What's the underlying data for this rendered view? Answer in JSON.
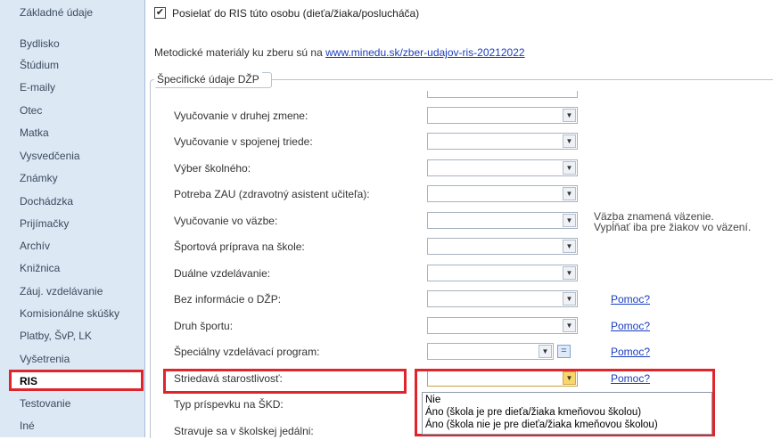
{
  "sidebar": {
    "items": [
      {
        "label": "Základné údaje"
      },
      {
        "label": "Bydlisko"
      },
      {
        "label": "Štúdium"
      },
      {
        "label": "E-maily"
      },
      {
        "label": "Otec"
      },
      {
        "label": "Matka"
      },
      {
        "label": "Vysvedčenia"
      },
      {
        "label": "Známky"
      },
      {
        "label": "Dochádzka"
      },
      {
        "label": "Prijímačky"
      },
      {
        "label": "Archív"
      },
      {
        "label": "Knižnica"
      },
      {
        "label": "Záuj. vzdelávanie"
      },
      {
        "label": "Komisionálne skúšky"
      },
      {
        "label": "Platby, ŠvP, LK"
      },
      {
        "label": "Vyšetrenia"
      },
      {
        "label": "RIS"
      },
      {
        "label": "Testovanie"
      },
      {
        "label": "Iné"
      }
    ],
    "active": "RIS"
  },
  "main": {
    "send_checkbox": {
      "checked": true,
      "check_glyph": "✔",
      "label": "Posielať do RIS túto osobu (dieťa/žiaka/poslucháča)"
    },
    "methodology_text": "Metodické materiály ku zberu sú na",
    "methodology_link": "www.minedu.sk/zber-udajov-ris-20212022",
    "group_title": "Špecifické údaje DŽP",
    "rows": [
      {
        "label": "Vyučovanie v druhej zmene:",
        "value": ""
      },
      {
        "label": "Vyučovanie v spojenej triede:",
        "value": ""
      },
      {
        "label": "Výber školného:",
        "value": ""
      },
      {
        "label": "Potreba ZAU (zdravotný asistent učiteľa):",
        "value": ""
      },
      {
        "label": "Vyučovanie vo väzbe:",
        "value": ""
      },
      {
        "label": "Športová príprava na škole:",
        "value": ""
      },
      {
        "label": "Duálne vzdelávanie:",
        "value": ""
      },
      {
        "label": "Bez informácie o DŽP:",
        "value": ""
      },
      {
        "label": "Druh športu:",
        "value": ""
      },
      {
        "label": "Špeciálny vzdelávací program:",
        "value": ""
      },
      {
        "label": "Striedavá starostlivosť:",
        "value": ""
      },
      {
        "label": "Typ príspevku na ŠKD:",
        "value": ""
      },
      {
        "label": "Stravuje sa v školskej jedálni:",
        "value": ""
      }
    ],
    "help_label": "Pomoc?",
    "eq_button_label": "=",
    "combo_arrow": "▼",
    "note_lines": [
      "Väzba znamená väzenie.",
      "Vypĺňať iba pre žiakov vo väzení."
    ],
    "dropdown_options": [
      "Nie",
      "Áno (škola je pre dieťa/žiaka kmeňovou školou)",
      "Áno (škola nie je pre dieťa/žiaka kmeňovou školou)"
    ]
  },
  "colors": {
    "highlight_red": "#e0242b",
    "link_blue": "#1a3dbf",
    "sidebar_bg": "#dde8f5"
  }
}
